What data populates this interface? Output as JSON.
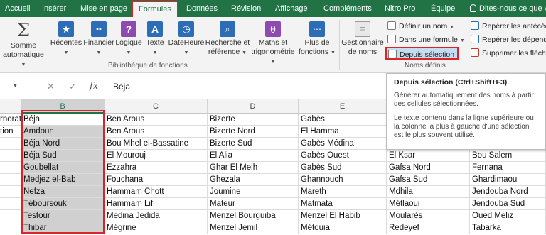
{
  "tabs": [
    {
      "label": "Accueil",
      "active": false
    },
    {
      "label": "Insérer",
      "active": false
    },
    {
      "label": "Mise en page",
      "active": false
    },
    {
      "label": "Formules",
      "active": true
    },
    {
      "label": "Données",
      "active": false
    },
    {
      "label": "Révision",
      "active": false
    },
    {
      "label": "Affichage",
      "active": false
    },
    {
      "label": "Compléments",
      "active": false
    },
    {
      "label": "Nitro Pro",
      "active": false
    },
    {
      "label": "Équipe",
      "active": false
    }
  ],
  "tell_me": "Dites-nous ce que vo",
  "ribbon": {
    "library": {
      "buttons": [
        {
          "line1": "Somme",
          "line2": "automatique",
          "icon": "sigma-icon"
        },
        {
          "line1": "Récentes",
          "line2": "",
          "icon": "star-book-icon"
        },
        {
          "line1": "Financier",
          "line2": "",
          "icon": "financial-book-icon"
        },
        {
          "line1": "Logique",
          "line2": "",
          "icon": "logical-book-icon"
        },
        {
          "line1": "Texte",
          "line2": "",
          "icon": "text-book-icon"
        },
        {
          "line1": "DateHeure",
          "line2": "",
          "icon": "clock-book-icon"
        },
        {
          "line1": "Recherche et",
          "line2": "référence",
          "icon": "search-book-icon"
        },
        {
          "line1": "Maths et",
          "line2": "trigonométrie",
          "icon": "theta-book-icon"
        },
        {
          "line1": "Plus de",
          "line2": "fonctions",
          "icon": "more-book-icon"
        }
      ],
      "label": "Bibliothèque de fonctions"
    },
    "names": {
      "manager": {
        "line1": "Gestionnaire",
        "line2": "de noms",
        "icon": "name-manager-icon"
      },
      "define": "Définir un nom",
      "use_in_formula": "Dans une formule",
      "create_from_selection": "Depuis sélection",
      "label": "Noms définis"
    },
    "audit": {
      "trace_precedents": "Repérer les antécéd",
      "trace_dependents": "Repérer les dépenda",
      "remove_arrows": "Supprimer les flèch"
    }
  },
  "formula_bar": {
    "cancel": "✕",
    "enter": "✓",
    "fx": "fx",
    "value": "Béja"
  },
  "tooltip": {
    "title": "Depuis sélection (Ctrl+Shift+F3)",
    "p1": "Générer automatiquement des noms à partir des cellules sélectionnées.",
    "p2": "Le texte contenu dans la ligne supérieure ou la colonne la plus à gauche d'une sélection est le plus souvent utilisé."
  },
  "grid": {
    "columns": [
      "B",
      "C",
      "D",
      "E"
    ],
    "col_a_rows": [
      "rnorat",
      "tion",
      "",
      "",
      "",
      "",
      "",
      "",
      "",
      ""
    ],
    "rows": [
      [
        "Béja",
        "Ben Arous",
        "Bizerte",
        "Gabès",
        "",
        ""
      ],
      [
        "Amdoun",
        "Ben Arous",
        "Bizerte Nord",
        "El Hamma",
        "",
        ""
      ],
      [
        "Béja Nord",
        "Bou Mhel el-Bassatine",
        "Bizerte Sud",
        "Gabès Médina",
        "",
        ""
      ],
      [
        "Béja Sud",
        "El Mourouj",
        "El Alia",
        "Gabès Ouest",
        "El Ksar",
        "Bou Salem"
      ],
      [
        "Goubellat",
        "Ezzahra",
        "Ghar El Melh",
        "Gabès Sud",
        "Gafsa Nord",
        "Fernana"
      ],
      [
        "Medjez el-Bab",
        "Fouchana",
        "Ghezala",
        "Ghannouch",
        "Gafsa Sud",
        "Ghardimaou"
      ],
      [
        "Nefza",
        "Hammam Chott",
        "Joumine",
        "Mareth",
        "Mdhila",
        "Jendouba Nord"
      ],
      [
        "Téboursouk",
        "Hammam Lif",
        "Mateur",
        "Matmata",
        "Métlaoui",
        "Jendouba Sud"
      ],
      [
        "Testour",
        "Medina Jedida",
        "Menzel Bourguiba",
        "Menzel El Habib",
        "Moularès",
        "Oued Meliz"
      ],
      [
        "Thibar",
        "Mégrine",
        "Menzel Jemil",
        "Métouia",
        "Redeyef",
        "Tabarka"
      ]
    ]
  }
}
